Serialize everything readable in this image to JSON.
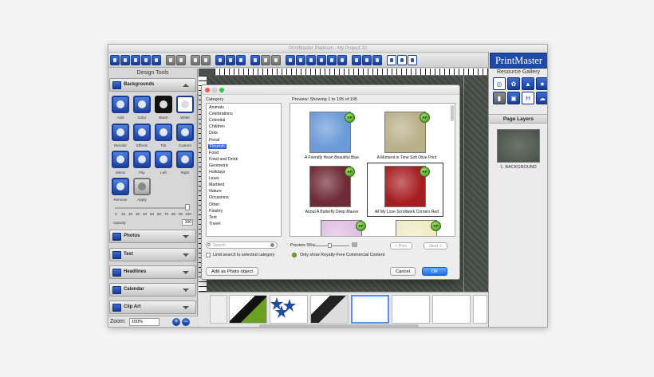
{
  "window": {
    "title": "PrintMaster Platinum - My Project 20"
  },
  "design_tools": {
    "title": "Design Tools",
    "backgrounds": {
      "label": "Backgrounds",
      "tools": [
        "Add",
        "Color",
        "Black",
        "White",
        "Recolor",
        "Effects",
        "Tile",
        "Custom",
        "Mirror",
        "Flip",
        "Left",
        "Right",
        "Remove",
        "Apply"
      ],
      "opacity_ticks": [
        "0",
        "10",
        "20",
        "30",
        "40",
        "50",
        "60",
        "70",
        "80",
        "90",
        "100"
      ],
      "opacity_label": "Opacity",
      "opacity_value": "100"
    },
    "panels": [
      "Photos",
      "Text",
      "Headlines",
      "Calendar",
      "Clip Art"
    ]
  },
  "zoom": {
    "label": "Zoom:",
    "value": "100%"
  },
  "resource_gallery": {
    "logo": "PrintMaster",
    "title": "Resource Gallery",
    "page_layers_title": "Page Layers",
    "layer_name": "1. BACKGROUND"
  },
  "dialog": {
    "category_label": "Category",
    "categories": [
      "Animals",
      "Celebrations",
      "Celestial",
      "Children",
      "Dots",
      "Floral",
      "Flourish",
      "Food",
      "Food and Drink",
      "Geometric",
      "Holidays",
      "Lines",
      "Marbled",
      "Nature",
      "Occasions",
      "Other",
      "Paisley",
      "Text",
      "Travel"
    ],
    "selected_category": "Flourish",
    "preview_label": "Preview: Showing 1 to 195 of 195",
    "thumbnails": [
      {
        "name": "A Friendly Heart Beautiful Blue",
        "badge": "RF",
        "color": "#6a9ad8"
      },
      {
        "name": "A Moment in Time Soft Olive Print",
        "badge": "RF",
        "color": "#b9b089"
      },
      {
        "name": "About A Butterfly Deep Mauve",
        "badge": "RF",
        "color": "#6e2a35"
      },
      {
        "name": "All My Love Scrollwork Corners Red",
        "badge": "RF",
        "color": "#a71e22"
      },
      {
        "name": "",
        "badge": "RF",
        "color": "#e0bfe3"
      },
      {
        "name": "",
        "badge": "RF",
        "color": "#f1ecc4"
      }
    ],
    "search_placeholder": "Search",
    "limit_search_label": "Limit search to selected category",
    "preview_size_label": "Preview Size:",
    "prev_label": "< Prev",
    "next_label": "Next >",
    "royalty_free_label": "Only show Royalty-Free Commercial Content",
    "add_photo_label": "Add as Photo object",
    "cancel_label": "Cancel",
    "ok_label": "OK"
  },
  "colors": {
    "accent": "#1e4aa8",
    "ok_button": "#1e6fe8",
    "rf_badge": "#6ab032"
  }
}
